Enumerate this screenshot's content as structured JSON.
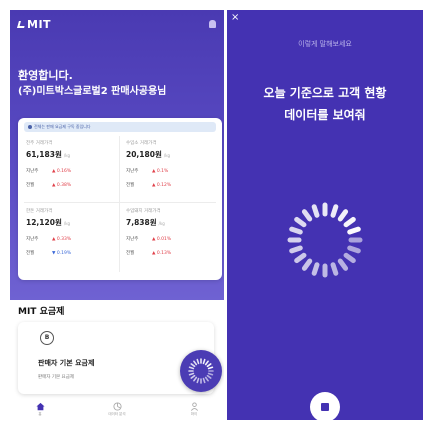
{
  "home": {
    "logo": "MIT",
    "welcome_line1": "환영합니다.",
    "welcome_line2": "(주)미트박스글로벌2 판매사공용님",
    "stats_banner": "전체는 판매 요금제 구독 중입니다",
    "cells": [
      {
        "label": "전주 거래가격",
        "value": "61,183원",
        "unit": "/kg",
        "rows": [
          {
            "label": "지난주",
            "value": "▲ 0.16%",
            "color": "red"
          },
          {
            "label": "전월",
            "value": "▲ 0.38%",
            "color": "red"
          }
        ]
      },
      {
        "label": "수입소 거래가격",
        "value": "20,180원",
        "unit": "/kg",
        "rows": [
          {
            "label": "지난주",
            "value": "▲ 0.1%",
            "color": "red"
          },
          {
            "label": "전월",
            "value": "▲ 0.12%",
            "color": "red"
          }
        ]
      },
      {
        "label": "한돈 거래가격",
        "value": "12,120원",
        "unit": "/kg",
        "rows": [
          {
            "label": "지난주",
            "value": "▲ 0.33%",
            "color": "red"
          },
          {
            "label": "전월",
            "value": "▼ 0.19%",
            "color": "blue"
          }
        ]
      },
      {
        "label": "수입돼지 거래가격",
        "value": "7,838원",
        "unit": "/kg",
        "rows": [
          {
            "label": "지난주",
            "value": "▲ 0.01%",
            "color": "red"
          },
          {
            "label": "전월",
            "value": "▲ 0.13%",
            "color": "red"
          }
        ]
      }
    ],
    "plan_section_title": "MIT 요금제",
    "plan_badge": "B",
    "plan_name": "판매자 기본 요금제",
    "plan_sub": "판매자 기본 요금제",
    "nav": [
      {
        "label": "홈",
        "icon": "home-icon"
      },
      {
        "label": "데이터 분석",
        "icon": "chart-icon"
      },
      {
        "label": "마이",
        "icon": "person-icon"
      }
    ]
  },
  "assistant": {
    "close": "×",
    "hint": "이렇게 말해보세요",
    "prompt_line1": "오늘 기준으로 고객 현황",
    "prompt_line2": "데이터를 보여줘"
  },
  "colors": {
    "brand_purple": "#4432b2",
    "up_red": "#e0404a",
    "down_blue": "#3a68d8"
  }
}
